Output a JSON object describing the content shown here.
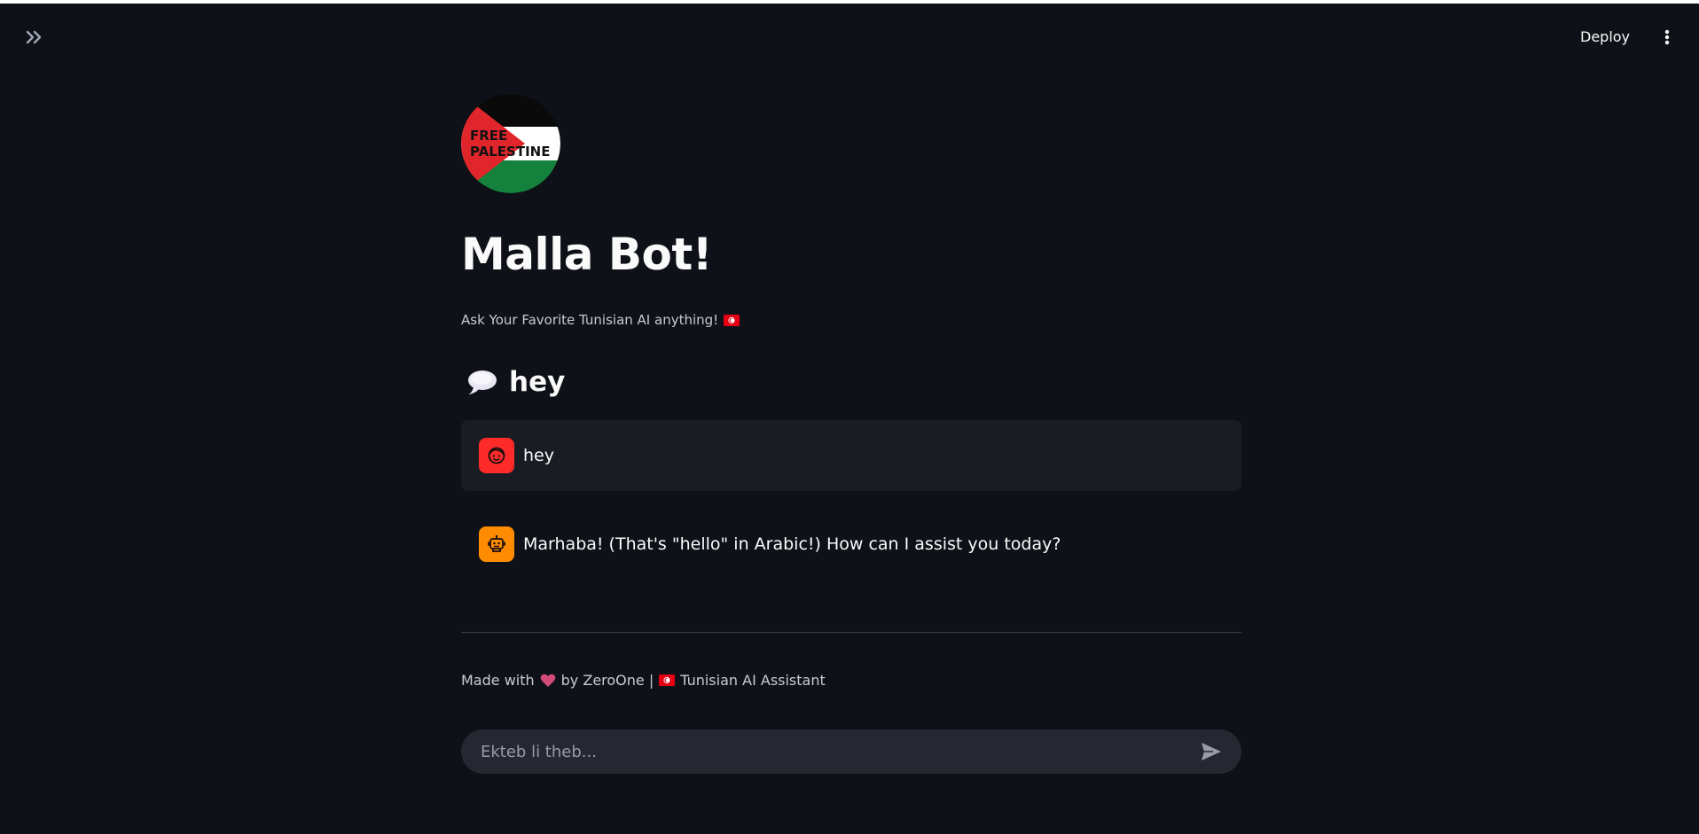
{
  "header": {
    "expand_icon": "chevron-double-right-icon",
    "deploy_label": "Deploy",
    "menu_icon": "vertical-ellipsis-icon"
  },
  "logo": {
    "text_line1": "FREE",
    "text_line2": "PALESTINE"
  },
  "page": {
    "title": "Malla Bot!",
    "subtitle": "Ask Your Favorite Tunisian AI anything!"
  },
  "chat": {
    "heading_icon": "speech-bubble-icon",
    "heading": "hey",
    "messages": [
      {
        "role": "user",
        "avatar_icon": "user-face-icon",
        "text": "hey"
      },
      {
        "role": "assistant",
        "avatar_icon": "robot-icon",
        "text": "Marhaba! (That's \"hello\" in Arabic!) How can I assist you today?"
      }
    ]
  },
  "footer": {
    "text_before": "Made with",
    "text_middle": "by ZeroOne |",
    "text_after": "Tunisian AI Assistant"
  },
  "input": {
    "placeholder": "Ekteb li theb...",
    "value": ""
  },
  "colors": {
    "background": "#0e1117",
    "user_avatar": "#ff2b2b",
    "bot_avatar": "#ff8c00",
    "user_message_bg": "#1a1c24",
    "input_bg": "#262730"
  }
}
